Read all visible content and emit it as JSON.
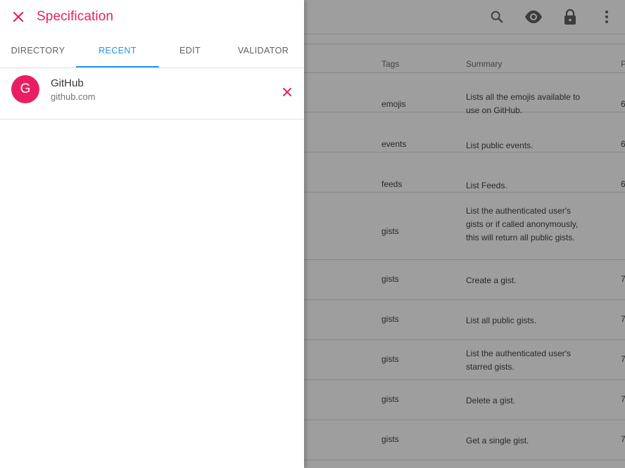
{
  "app": {
    "icons": [
      "search-icon",
      "eye-icon",
      "lock-icon",
      "more-vert-icon"
    ],
    "table": {
      "headers": {
        "tags": "Tags",
        "summary": "Summary",
        "p": "P"
      },
      "rows": [
        {
          "tag": "emojis",
          "summary": "Lists all the emojis available to use on GitHub.",
          "num": "6"
        },
        {
          "tag": "events",
          "summary": "List public events.",
          "num": "6"
        },
        {
          "tag": "feeds",
          "summary": "List Feeds.",
          "num": "6"
        },
        {
          "tag": "gists",
          "summary": "List the authenticated user's gists or if called anonymously, this will return all public gists.",
          "num": ""
        },
        {
          "tag": "gists",
          "summary": "Create a gist.",
          "num": "7"
        },
        {
          "tag": "gists",
          "summary": "List all public gists.",
          "num": "7"
        },
        {
          "tag": "gists",
          "summary": "List the authenticated user's starred gists.",
          "num": "7"
        },
        {
          "tag": "gists",
          "summary": "Delete a gist.",
          "num": "7"
        },
        {
          "tag": "gists",
          "summary": "Get a single gist.",
          "num": "7"
        }
      ]
    }
  },
  "drawer": {
    "title": "Specification",
    "tabs": [
      {
        "label": "DIRECTORY",
        "active": false
      },
      {
        "label": "RECENT",
        "active": true
      },
      {
        "label": "EDIT",
        "active": false
      },
      {
        "label": "VALIDATOR",
        "active": false
      }
    ],
    "recent": [
      {
        "avatar_letter": "G",
        "title": "GitHub",
        "subtitle": "github.com"
      }
    ]
  },
  "colors": {
    "accent": "#e91e63",
    "tab_active": "#2196f3"
  }
}
